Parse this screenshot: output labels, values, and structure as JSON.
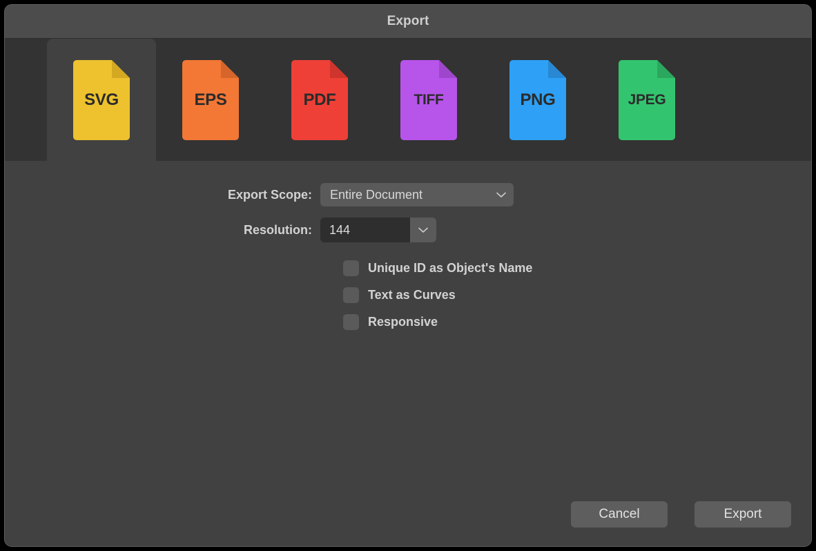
{
  "window": {
    "title": "Export"
  },
  "format_tabs": {
    "selected": "SVG",
    "items": [
      {
        "label": "SVG",
        "color": "#eec22e",
        "fold_color": "#d4a821",
        "icon": "svg-file-icon"
      },
      {
        "label": "EPS",
        "color": "#f37735",
        "fold_color": "#d6652b",
        "icon": "eps-file-icon"
      },
      {
        "label": "PDF",
        "color": "#ee4037",
        "fold_color": "#cf352d",
        "icon": "pdf-file-icon"
      },
      {
        "label": "TIFF",
        "color": "#b754ea",
        "fold_color": "#9e47cc",
        "icon": "tiff-file-icon"
      },
      {
        "label": "PNG",
        "color": "#2ea0f5",
        "fold_color": "#2888d4",
        "icon": "png-file-icon"
      },
      {
        "label": "JPEG",
        "color": "#33c46f",
        "fold_color": "#2ba85e",
        "icon": "jpeg-file-icon"
      }
    ]
  },
  "form": {
    "export_scope": {
      "label": "Export Scope:",
      "value": "Entire Document",
      "options": [
        "Entire Document"
      ]
    },
    "resolution": {
      "label": "Resolution:",
      "value": "144",
      "options": [
        "144"
      ]
    },
    "checkboxes": [
      {
        "label": "Unique ID as Object's Name",
        "checked": false
      },
      {
        "label": "Text as Curves",
        "checked": false
      },
      {
        "label": "Responsive",
        "checked": false
      }
    ]
  },
  "footer": {
    "cancel_label": "Cancel",
    "export_label": "Export"
  }
}
